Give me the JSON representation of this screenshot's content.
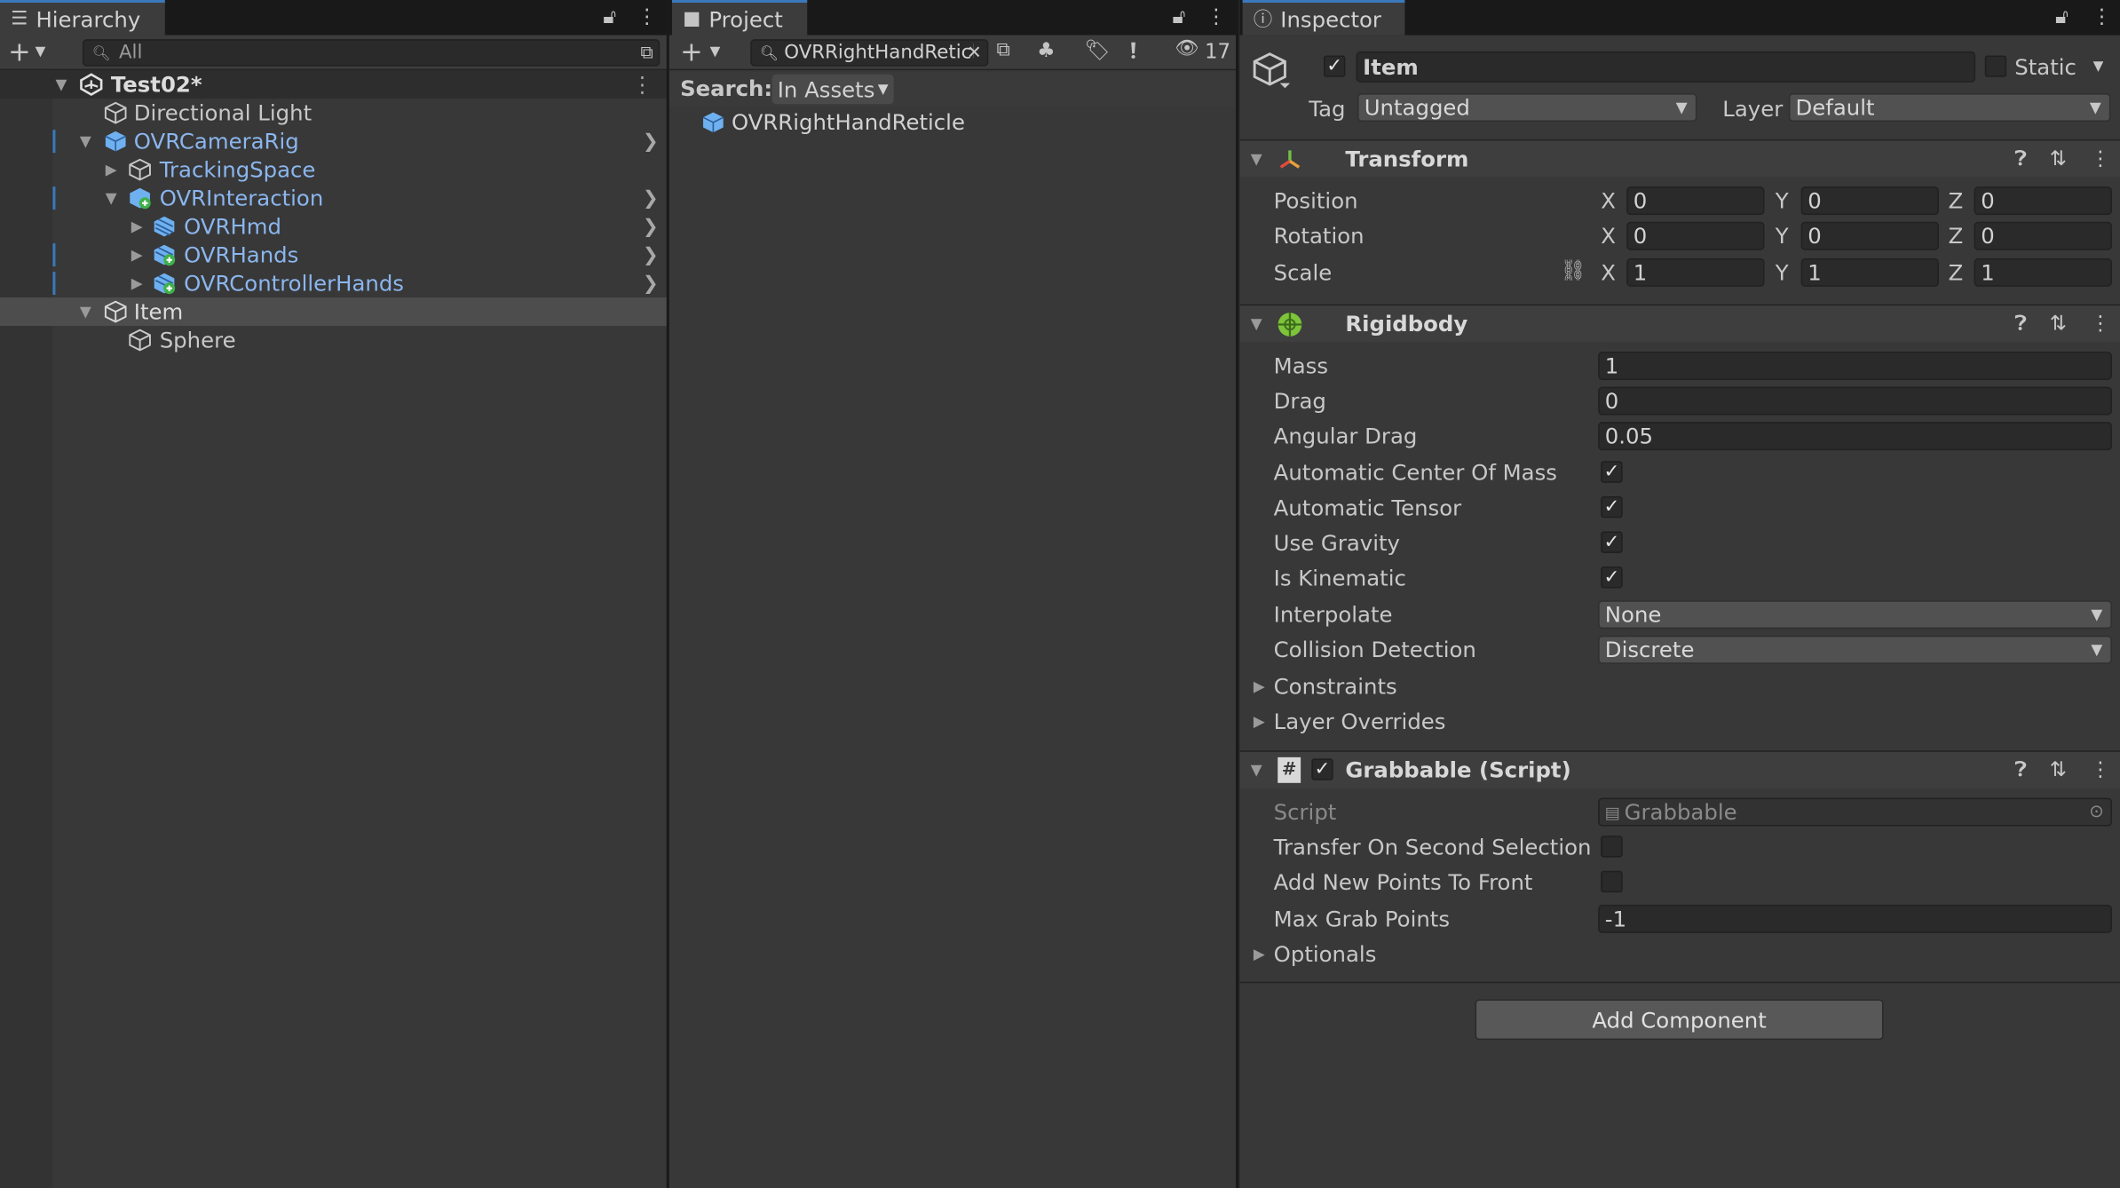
{
  "hierarchy": {
    "tab_label": "Hierarchy",
    "search_placeholder": "All",
    "scene": "Test02*",
    "items": [
      {
        "label": "Directional Light"
      },
      {
        "label": "OVRCameraRig"
      },
      {
        "label": "TrackingSpace"
      },
      {
        "label": "OVRInteraction"
      },
      {
        "label": "OVRHmd"
      },
      {
        "label": "OVRHands"
      },
      {
        "label": "OVRControllerHands"
      },
      {
        "label": "Item"
      },
      {
        "label": "Sphere"
      }
    ]
  },
  "project": {
    "tab_label": "Project",
    "search_value": "OVRRightHandReticl⁠e",
    "search_label": "Search:",
    "search_scope": "In Assets",
    "hidden_count": "17",
    "result": "OVRRightHandReticle"
  },
  "inspector": {
    "tab_label": "Inspector",
    "object_name": "Item",
    "static_label": "Static",
    "tag_label": "Tag",
    "tag_value": "Untagged",
    "layer_label": "Layer",
    "layer_value": "Default",
    "transform": {
      "title": "Transform",
      "position_label": "Position",
      "rotation_label": "Rotation",
      "scale_label": "Scale",
      "axis_x": "X",
      "axis_y": "Y",
      "axis_z": "Z",
      "position": [
        "0",
        "0",
        "0"
      ],
      "rotation": [
        "0",
        "0",
        "0"
      ],
      "scale": [
        "1",
        "1",
        "1"
      ]
    },
    "rigidbody": {
      "title": "Rigidbody",
      "mass_label": "Mass",
      "mass": "1",
      "drag_label": "Drag",
      "drag": "0",
      "angular_drag_label": "Angular Drag",
      "angular_drag": "0.05",
      "auto_com_label": "Automatic Center Of Mass",
      "auto_tensor_label": "Automatic Tensor",
      "use_gravity_label": "Use Gravity",
      "is_kinematic_label": "Is Kinematic",
      "interpolate_label": "Interpolate",
      "interpolate": "None",
      "collision_label": "Collision Detection",
      "collision": "Discrete",
      "constraints_label": "Constraints",
      "layer_overrides_label": "Layer Overrides"
    },
    "grabbable": {
      "title": "Grabbable (Script)",
      "script_label": "Script",
      "script_value": "Grabbable",
      "transfer_label": "Transfer On Second Selection",
      "add_front_label": "Add New Points To Front",
      "max_points_label": "Max Grab Points",
      "max_points": "-1",
      "optionals_label": "Optionals"
    },
    "add_component": "Add Component"
  },
  "colors": {
    "accent": "#3a79bb",
    "prefab_blue": "#8bb6ee",
    "panel": "#383838"
  }
}
